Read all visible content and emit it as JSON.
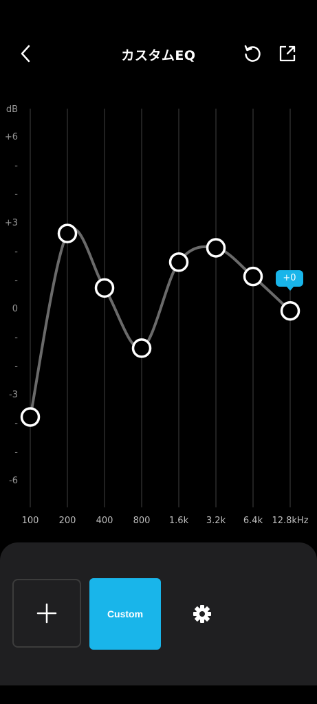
{
  "header": {
    "title": "カスタムEQ",
    "back_icon": "back-chevron-icon",
    "reset_icon": "reset-icon",
    "share_icon": "share-icon"
  },
  "eq": {
    "y_unit": "dB",
    "y_labels": [
      "+6",
      "-",
      "-",
      "+3",
      "-",
      "-",
      "0",
      "-",
      "-",
      "-3",
      "-",
      "-",
      "-6"
    ],
    "bands": [
      {
        "label": "100",
        "gain": -3.7
      },
      {
        "label": "200",
        "gain": 2.7
      },
      {
        "label": "400",
        "gain": 0.8
      },
      {
        "label": "800",
        "gain": -1.3
      },
      {
        "label": "1.6k",
        "gain": 1.7
      },
      {
        "label": "3.2k",
        "gain": 2.2
      },
      {
        "label": "6.4k",
        "gain": 1.2
      },
      {
        "label": "12.8kHz",
        "gain": 0
      }
    ],
    "y_range": [
      -6,
      6
    ],
    "selected_value": "+0",
    "colors": {
      "curve": "#6a6a6a",
      "grid": "#2c2c2c",
      "accent": "#19b5ea"
    }
  },
  "bottom": {
    "add_icon": "plus-icon",
    "custom_label": "Custom",
    "settings_icon": "gear-icon"
  }
}
